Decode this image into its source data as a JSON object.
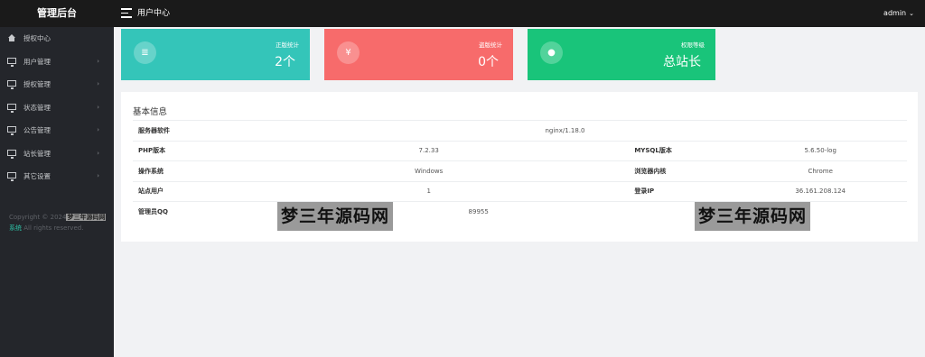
{
  "topbar": {
    "brand": "管理后台",
    "page_title": "用户中心",
    "user": "admin"
  },
  "sidebar": {
    "items": [
      {
        "label": "授权中心",
        "icon": "home-icon",
        "has_arrow": false
      },
      {
        "label": "用户管理",
        "icon": "monitor-icon",
        "has_arrow": true
      },
      {
        "label": "授权管理",
        "icon": "monitor-icon",
        "has_arrow": true
      },
      {
        "label": "状态管理",
        "icon": "monitor-icon",
        "has_arrow": true
      },
      {
        "label": "公告管理",
        "icon": "monitor-icon",
        "has_arrow": true
      },
      {
        "label": "站长管理",
        "icon": "monitor-icon",
        "has_arrow": true
      },
      {
        "label": "其它设置",
        "icon": "monitor-icon",
        "has_arrow": true
      }
    ],
    "arrow": "›",
    "copyright_prefix": "Copyright © 2024",
    "copyright_watermark": "梦三年源码网",
    "copyright_system": "系统",
    "copyright_suffix": " All rights reserved."
  },
  "cards": [
    {
      "label": "正版统计",
      "value": "2个",
      "icon": "list-icon",
      "glyph": "≣",
      "color": "#34c5b9"
    },
    {
      "label": "盗版统计",
      "value": "0个",
      "icon": "yen-icon",
      "glyph": "¥",
      "color": "#f76b6b"
    },
    {
      "label": "权限等级",
      "value": "总站长",
      "icon": "user-circle-icon",
      "glyph": "●",
      "color": "#19c47a"
    }
  ],
  "info": {
    "title": "基本信息",
    "server_software_label": "服务器软件",
    "server_software": "nginx/1.18.0",
    "php_label": "PHP版本",
    "php": "7.2.33",
    "mysql_label": "MYSQL版本",
    "mysql": "5.6.50-log",
    "os_label": "操作系统",
    "os": "Windows",
    "browser_label": "浏览器内核",
    "browser": "Chrome",
    "site_users_label": "站点用户",
    "site_users": "1",
    "login_ip_label": "登录IP",
    "login_ip": "36.161.208.124",
    "admin_qq_label": "管理员QQ",
    "admin_qq": "89955"
  },
  "watermark": "梦三年源码网"
}
